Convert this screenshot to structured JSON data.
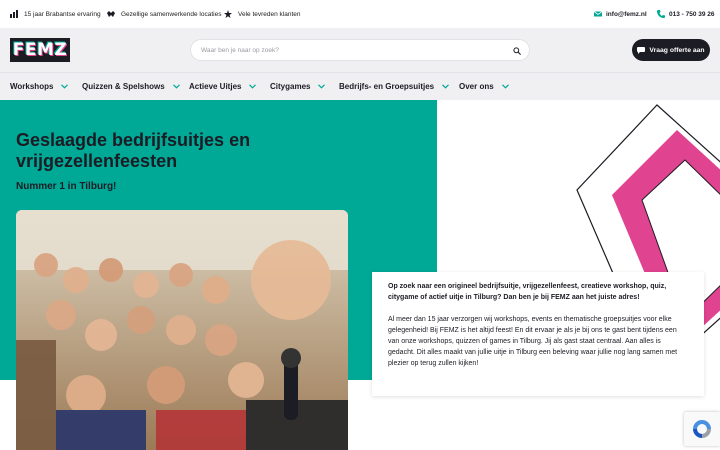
{
  "topbar": {
    "usps": [
      {
        "icon": "bar-chart-icon",
        "label": "15 jaar Brabantse ervaring"
      },
      {
        "icon": "handshake-icon",
        "label": "Gezellige samenwerkende locaties"
      },
      {
        "icon": "star-icon",
        "label": "Vele tevreden klanten"
      }
    ],
    "email": {
      "icon": "envelope-icon",
      "label": "info@femz.nl"
    },
    "phone": {
      "icon": "phone-icon",
      "label": "013 - 750 39 26"
    }
  },
  "header": {
    "logo_text": "FEMZ",
    "search": {
      "placeholder": "Waar ben je naar op zoek?",
      "value": ""
    },
    "cta_label": "Vraag offerte aan"
  },
  "nav": {
    "items": [
      {
        "label": "Workshops"
      },
      {
        "label": "Quizzen & Spelshows"
      },
      {
        "label": "Actieve Uitjes"
      },
      {
        "label": "Citygames"
      },
      {
        "label": "Bedrijfs- en Groepsuitjes"
      },
      {
        "label": "Over ons"
      }
    ]
  },
  "hero": {
    "title": "Geslaagde bedrijfsuitjes en vrijgezellenfeesten",
    "subtitle": "Nummer 1 in Tilburg!"
  },
  "card": {
    "lead": "Op zoek naar een origineel bedrijfsuitje, vrijgezellenfeest, creatieve workshop, quiz, citygame of actief uitje in Tilburg? Dan ben je bij FEMZ aan het juiste adres!",
    "body": "Al meer dan 15 jaar verzorgen wij workshops, events en thematische groepsuitjes voor elke gelegenheid! Bij FEMZ is het altijd feest! En dit ervaar je als je bij ons te gast bent tijdens een van onze workshops, quizzen of games in Tilburg. Jij als gast staat centraal. Aan alles is gedacht. Dit alles maakt van jullie uitje in Tilburg een beleving waar jullie nog lang samen met plezier op terug zullen kijken!"
  },
  "colors": {
    "accent_teal": "#00a896",
    "accent_pink": "#e0438f",
    "dark": "#1c1c24"
  }
}
